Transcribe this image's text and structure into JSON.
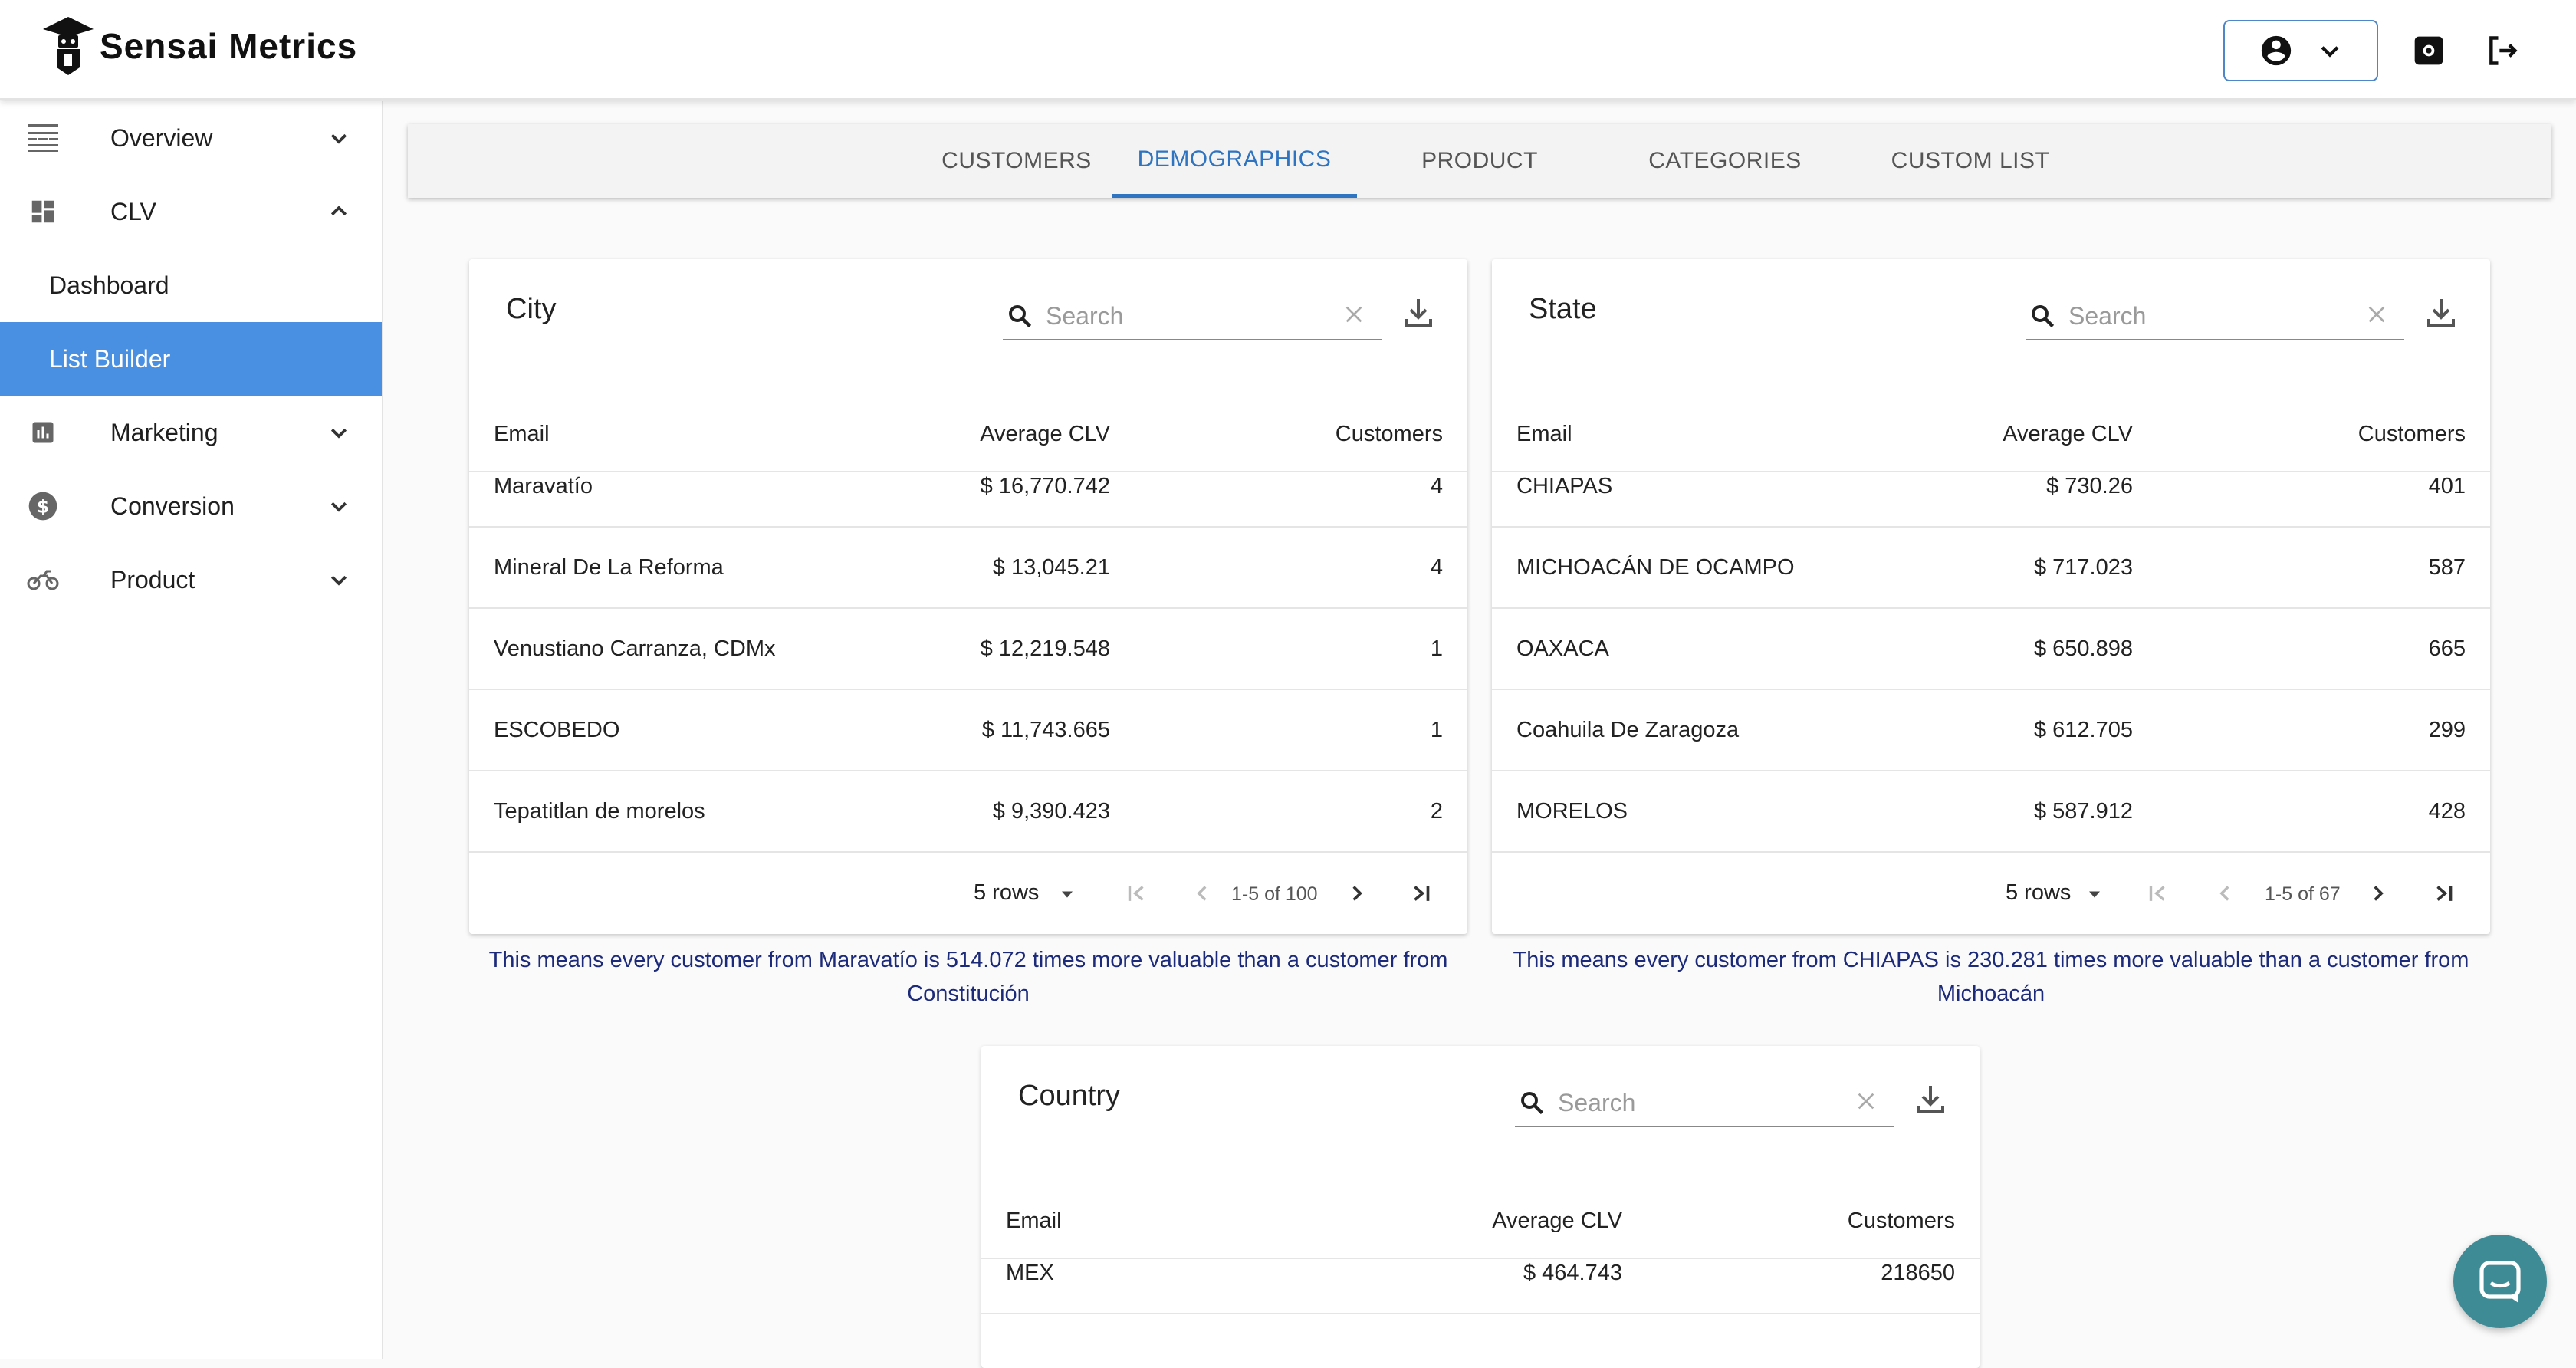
{
  "app": {
    "name": "Sensai Metrics"
  },
  "sidebar": {
    "items": [
      {
        "label": "Overview",
        "icon": "overview-icon",
        "expanded": false
      },
      {
        "label": "CLV",
        "icon": "dashboard-icon",
        "expanded": true,
        "children": [
          {
            "label": "Dashboard",
            "active": false
          },
          {
            "label": "List Builder",
            "active": true
          }
        ]
      },
      {
        "label": "Marketing",
        "icon": "bar-chart-icon",
        "expanded": false
      },
      {
        "label": "Conversion",
        "icon": "dollar-icon",
        "expanded": false
      },
      {
        "label": "Product",
        "icon": "motorcycle-icon",
        "expanded": false
      }
    ]
  },
  "tabs": [
    {
      "label": "CUSTOMERS",
      "active": false
    },
    {
      "label": "DEMOGRAPHICS",
      "active": true
    },
    {
      "label": "PRODUCT",
      "active": false
    },
    {
      "label": "CATEGORIES",
      "active": false
    },
    {
      "label": "CUSTOM LIST",
      "active": false
    }
  ],
  "city": {
    "title": "City",
    "search_placeholder": "Search",
    "columns": [
      "Email",
      "Average CLV",
      "Customers"
    ],
    "rows": [
      [
        "Maravatío",
        "$ 16,770.742",
        "4"
      ],
      [
        "Mineral De La Reforma",
        "$ 13,045.21",
        "4"
      ],
      [
        "Venustiano Carranza, CDMx",
        "$ 12,219.548",
        "1"
      ],
      [
        "ESCOBEDO",
        "$ 11,743.665",
        "1"
      ],
      [
        "Tepatitlan de morelos",
        "$ 9,390.423",
        "2"
      ]
    ],
    "rows_per_page": "5 rows",
    "range": "1-5 of 100",
    "note": "This means every customer from Maravatío is 514.072 times more valuable than a customer from Constitución"
  },
  "state": {
    "title": "State",
    "search_placeholder": "Search",
    "columns": [
      "Email",
      "Average CLV",
      "Customers"
    ],
    "rows": [
      [
        "CHIAPAS",
        "$ 730.26",
        "401"
      ],
      [
        "MICHOACÁN DE OCAMPO",
        "$ 717.023",
        "587"
      ],
      [
        "OAXACA",
        "$ 650.898",
        "665"
      ],
      [
        "Coahuila De Zaragoza",
        "$ 612.705",
        "299"
      ],
      [
        "MORELOS",
        "$ 587.912",
        "428"
      ]
    ],
    "rows_per_page": "5 rows",
    "range": "1-5 of 67",
    "note": "This means every customer from CHIAPAS is 230.281 times more valuable than a customer from Michoacán"
  },
  "country": {
    "title": "Country",
    "search_placeholder": "Search",
    "columns": [
      "Email",
      "Average CLV",
      "Customers"
    ],
    "rows": [
      [
        "MEX",
        "$ 464.743",
        "218650"
      ]
    ]
  },
  "colors": {
    "accent": "#4a90e2",
    "tab_active": "#2f74c0",
    "note_text": "#1c2a7a",
    "chat": "#3f8b95"
  }
}
